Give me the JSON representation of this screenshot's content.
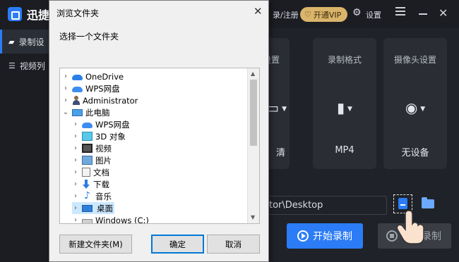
{
  "app": {
    "title": "迅捷",
    "login_text": "录/注册",
    "vip_label": "开通VIP",
    "settings_label": "设置",
    "sidebar": [
      {
        "label": "录制设",
        "icon": "video-camera-icon",
        "active": true
      },
      {
        "label": "视频列",
        "icon": "list-icon",
        "active": false
      }
    ],
    "cards": [
      {
        "title": "设置",
        "value": "清",
        "icon": "monitor-icon"
      },
      {
        "title": "录制格式",
        "value": "MP4",
        "icon": "file-icon"
      },
      {
        "title": "摄像头设置",
        "value": "无设备",
        "icon": "webcam-icon"
      }
    ],
    "path_value": "tor\\Desktop",
    "start_label": "开始录制",
    "stop_label": "录制",
    "accent_color": "#2b7cf6",
    "vip_color": "#d9b46a"
  },
  "dialog": {
    "title": "浏览文件夹",
    "close_glyph": "✕",
    "prompt": "选择一个文件夹",
    "tree": [
      {
        "label": "OneDrive",
        "icon": "onedrive-cloud-icon",
        "level": 0,
        "chevron": "›",
        "selected": false
      },
      {
        "label": "WPS网盘",
        "icon": "wps-cloud-icon",
        "level": 0,
        "chevron": "›",
        "selected": false
      },
      {
        "label": "Administrator",
        "icon": "user-icon",
        "level": 0,
        "chevron": "›",
        "selected": false
      },
      {
        "label": "此电脑",
        "icon": "this-pc-icon",
        "level": 0,
        "chevron": "⌄",
        "selected": false
      },
      {
        "label": "WPS网盘",
        "icon": "wps-cloud-icon",
        "level": 1,
        "chevron": "›",
        "selected": false
      },
      {
        "label": "3D 对象",
        "icon": "3d-objects-icon",
        "level": 1,
        "chevron": "›",
        "selected": false
      },
      {
        "label": "视频",
        "icon": "video-folder-icon",
        "level": 1,
        "chevron": "›",
        "selected": false
      },
      {
        "label": "图片",
        "icon": "pictures-folder-icon",
        "level": 1,
        "chevron": "›",
        "selected": false
      },
      {
        "label": "文档",
        "icon": "documents-folder-icon",
        "level": 1,
        "chevron": "›",
        "selected": false
      },
      {
        "label": "下载",
        "icon": "downloads-folder-icon",
        "level": 1,
        "chevron": "›",
        "selected": false
      },
      {
        "label": "音乐",
        "icon": "music-folder-icon",
        "level": 1,
        "chevron": "›",
        "selected": false
      },
      {
        "label": "桌面",
        "icon": "desktop-folder-icon",
        "level": 1,
        "chevron": "›",
        "selected": true
      },
      {
        "label": "Windows (C:)",
        "icon": "drive-icon",
        "level": 1,
        "chevron": "›",
        "selected": false
      }
    ],
    "buttons": {
      "new_folder": "新建文件夹(M)",
      "ok": "确定",
      "cancel": "取消"
    }
  }
}
